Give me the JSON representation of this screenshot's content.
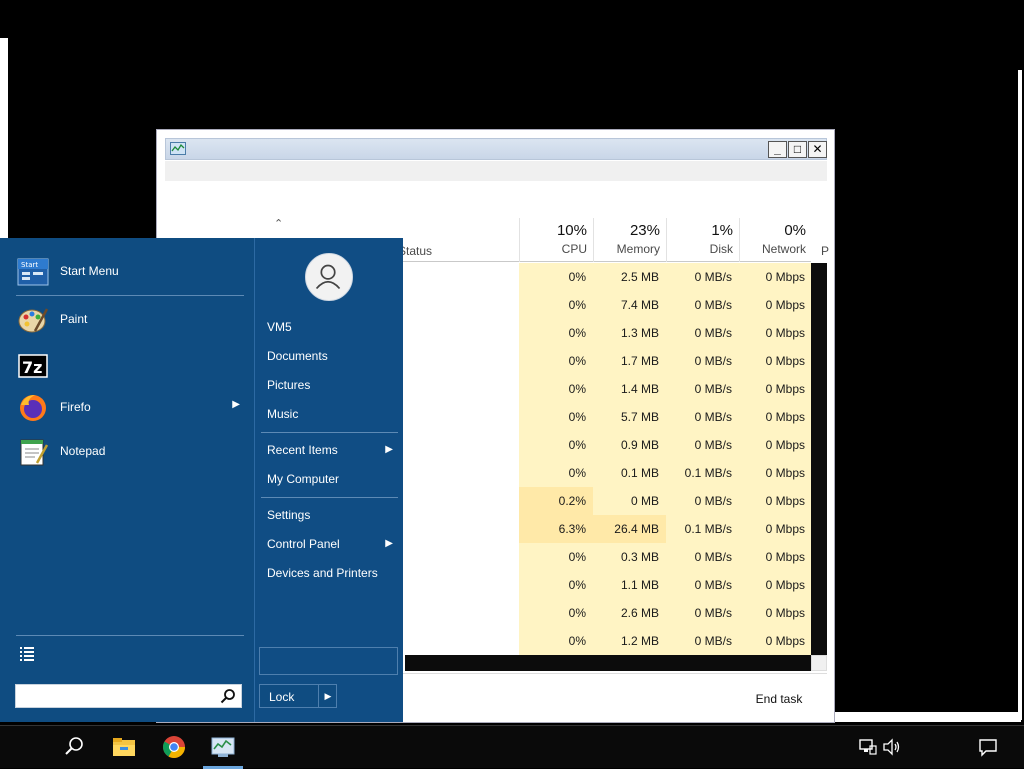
{
  "task_manager": {
    "status_header": "Status",
    "p_header": "P",
    "columns": [
      {
        "pct": "10%",
        "label": "CPU"
      },
      {
        "pct": "23%",
        "label": "Memory"
      },
      {
        "pct": "1%",
        "label": "Disk"
      },
      {
        "pct": "0%",
        "label": "Network"
      }
    ],
    "rows": [
      {
        "cpu": "0%",
        "mem": "2.5 MB",
        "disk": "0 MB/s",
        "net": "0 Mbps"
      },
      {
        "cpu": "0%",
        "mem": "7.4 MB",
        "disk": "0 MB/s",
        "net": "0 Mbps"
      },
      {
        "cpu": "0%",
        "mem": "1.3 MB",
        "disk": "0 MB/s",
        "net": "0 Mbps"
      },
      {
        "cpu": "0%",
        "mem": "1.7 MB",
        "disk": "0 MB/s",
        "net": "0 Mbps"
      },
      {
        "cpu": "0%",
        "mem": "1.4 MB",
        "disk": "0 MB/s",
        "net": "0 Mbps"
      },
      {
        "cpu": "0%",
        "mem": "5.7 MB",
        "disk": "0 MB/s",
        "net": "0 Mbps"
      },
      {
        "cpu": "0%",
        "mem": "0.9 MB",
        "disk": "0 MB/s",
        "net": "0 Mbps"
      },
      {
        "cpu": "0%",
        "mem": "0.1 MB",
        "disk": "0.1 MB/s",
        "net": "0 Mbps"
      },
      {
        "cpu": "0.2%",
        "mem": "0 MB",
        "disk": "0 MB/s",
        "net": "0 Mbps"
      },
      {
        "cpu": "6.3%",
        "mem": "26.4 MB",
        "disk": "0.1 MB/s",
        "net": "0 Mbps"
      },
      {
        "cpu": "0%",
        "mem": "0.3 MB",
        "disk": "0 MB/s",
        "net": "0 Mbps"
      },
      {
        "cpu": "0%",
        "mem": "1.1 MB",
        "disk": "0 MB/s",
        "net": "0 Mbps"
      },
      {
        "cpu": "0%",
        "mem": "2.6 MB",
        "disk": "0 MB/s",
        "net": "0 Mbps"
      },
      {
        "cpu": "0%",
        "mem": "1.2 MB",
        "disk": "0 MB/s",
        "net": "0 Mbps"
      }
    ],
    "end_task_label": "End task",
    "colors": {
      "cell_light": "#fff4c4",
      "cell_mid": "#ffe9a8"
    }
  },
  "start_menu": {
    "programs": [
      {
        "label": "Start Menu",
        "icon": "start-menu-icon",
        "has_arrow": false
      },
      {
        "label": "Paint",
        "icon": "paint-icon",
        "has_arrow": false
      },
      {
        "label": "",
        "icon": "7zip-icon",
        "has_arrow": false
      },
      {
        "label": "Firefo",
        "icon": "firefox-icon",
        "has_arrow": true
      },
      {
        "label": "Notepad",
        "icon": "notepad-icon",
        "has_arrow": false
      }
    ],
    "start_icon_text": "Start",
    "sevenzip_text": "7z",
    "right_items": [
      {
        "label": "VM5",
        "has_arrow": false
      },
      {
        "label": "Documents",
        "has_arrow": false
      },
      {
        "label": "Pictures",
        "has_arrow": false
      },
      {
        "label": "Music",
        "has_arrow": false
      },
      {
        "label": "Recent Items",
        "has_arrow": true
      },
      {
        "label": "My Computer",
        "has_arrow": false
      },
      {
        "label": "Settings",
        "has_arrow": false
      },
      {
        "label": "Control Panel",
        "has_arrow": true
      },
      {
        "label": "Devices and Printers",
        "has_arrow": false
      }
    ],
    "search_placeholder": "",
    "lock_label": "Lock",
    "arrow_glyph": "▶",
    "colors": {
      "bg": "#0f4c81"
    }
  },
  "taskbar": {
    "icons": [
      "search-icon",
      "file-explorer-icon",
      "chrome-icon",
      "task-manager-icon"
    ],
    "tray": [
      "network-icon",
      "volume-icon",
      "notification-icon"
    ]
  }
}
